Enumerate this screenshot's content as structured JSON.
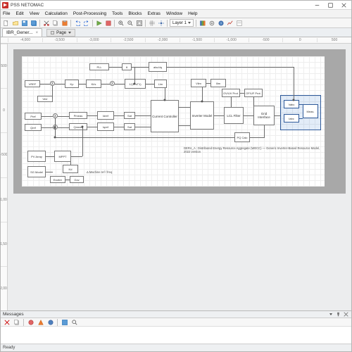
{
  "titlebar": {
    "title": "PSS NETOMAC"
  },
  "menu": {
    "items": [
      "File",
      "Edit",
      "View",
      "Calculation",
      "Post-Processing",
      "Tools",
      "Blocks",
      "Extras",
      "Window",
      "Help"
    ]
  },
  "toolbar": {
    "layer_label": "Layer",
    "layer_value": "Layer 1"
  },
  "tab": {
    "filename": "IBR_Gener... ",
    "subtab": "Page"
  },
  "ruler_h": [
    "-4,000",
    "-3,500",
    "-3,000",
    "-2,500",
    "-2,000",
    "-1,500",
    "-1,000",
    "-500",
    "0",
    "500"
  ],
  "ruler_v": [
    "500",
    "0",
    "-500",
    "-1,000",
    "-1,500",
    "-2,000"
  ],
  "blocks": {
    "vref": "VREF",
    "verr": "Verr",
    "kp": "Kp",
    "ki": "Ki/s",
    "sum": "Σ",
    "lag1": "1/(1+sT1)",
    "lim1": "Lim",
    "pmeas": "Pmeas",
    "pref": "Pref",
    "qmeas": "Qmeas",
    "qref": "Qref",
    "pll": "PLL",
    "theta": "θ",
    "iqref": "Iqref",
    "idref": "Idref",
    "curctl": "Current\nController",
    "inv": "Inverter\nModel",
    "filt": "LCL\nFilter",
    "grid": "Grid\nInterface",
    "vabc": "Vabc",
    "iabc": "Iabc",
    "dq": "abc/dq",
    "satd": "Sat",
    "satq": "Sat",
    "kdq": "Kd",
    "protA": "OV/UV\nProt.",
    "protB": "OF/UF\nProt.",
    "meas": "Meas.",
    "pq": "PQ\nCalc",
    "vlim": "Vlim",
    "ilim": "Ilim",
    "machine": "SG\nModel",
    "exc": "Exciter",
    "gov": "Gov",
    "pvsrc": "PV\nArray",
    "mppt": "MPPT",
    "note1": "DERA_A : Distributed Energy Resource Aggregate (WECC) — Generic Inverter-Based Resource Model, 2022 version",
    "note2": "Δ Machine ref / freq"
  },
  "panels": {
    "messages": "Messages",
    "ready": "Ready"
  }
}
